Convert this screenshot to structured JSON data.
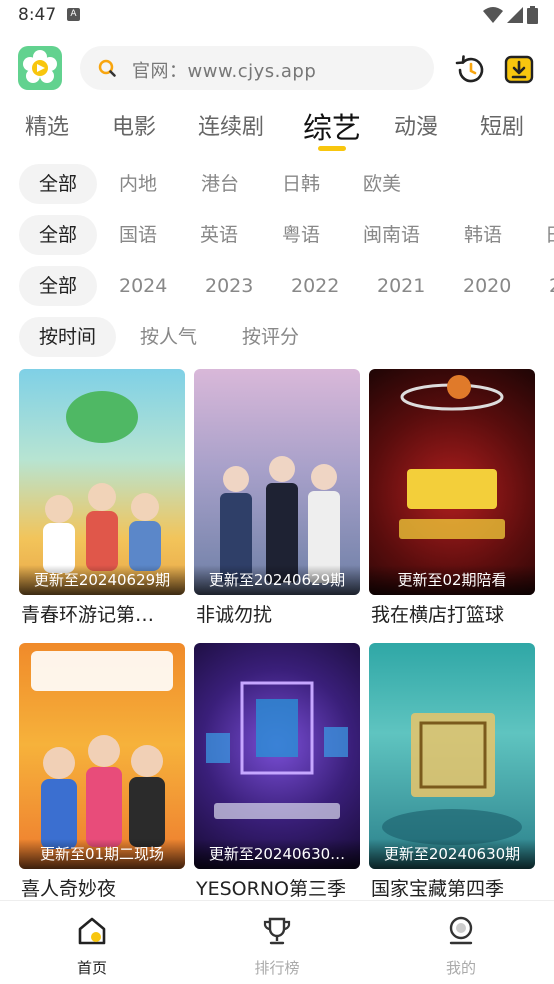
{
  "status_bar": {
    "time": "8:47",
    "notification": "A"
  },
  "header": {
    "search_placeholder": "官网：www.cjys.app"
  },
  "categories": [
    {
      "label": "精选"
    },
    {
      "label": "电影"
    },
    {
      "label": "连续剧"
    },
    {
      "label": "综艺"
    },
    {
      "label": "动漫"
    },
    {
      "label": "短剧"
    }
  ],
  "active_category": "综艺",
  "filters": {
    "region": [
      "全部",
      "内地",
      "港台",
      "日韩",
      "欧美"
    ],
    "language": [
      "全部",
      "国语",
      "英语",
      "粤语",
      "闽南语",
      "韩语",
      "日"
    ],
    "year": [
      "全部",
      "2024",
      "2023",
      "2022",
      "2021",
      "2020",
      "2"
    ],
    "sort": [
      "按时间",
      "按人气",
      "按评分"
    ]
  },
  "cards": [
    {
      "status": "更新至20240629期",
      "title": "青春环游记第…"
    },
    {
      "status": "更新至20240629期",
      "title": "非诚勿扰"
    },
    {
      "status": "更新至02期陪看",
      "title": "我在横店打篮球"
    },
    {
      "status": "更新至01期二现场",
      "title": "喜人奇妙夜"
    },
    {
      "status": "更新至20240630…",
      "title": "YESORNO第三季"
    },
    {
      "status": "更新至20240630期",
      "title": "国家宝藏第四季"
    }
  ],
  "bottom_nav": [
    {
      "label": "首页"
    },
    {
      "label": "排行榜"
    },
    {
      "label": "我的"
    }
  ],
  "colors": {
    "accent": "#f8c60e",
    "logo_green": "#62d28f"
  }
}
